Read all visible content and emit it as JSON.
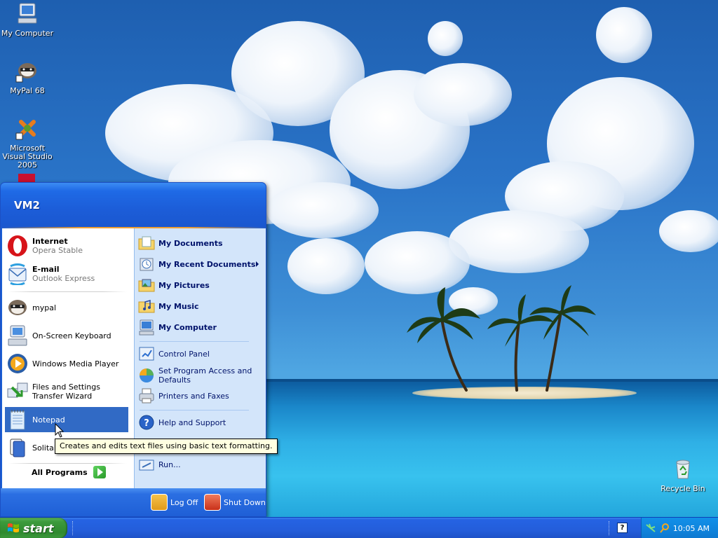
{
  "desktop": {
    "icons": [
      {
        "label": "My Computer",
        "icon": "my-computer-icon"
      },
      {
        "label": "MyPal 68",
        "icon": "mypal-raccoon-icon"
      },
      {
        "label": "Microsoft Visual Studio 2005",
        "icon": "visual-studio-icon"
      },
      {
        "label": "Recycle Bin",
        "icon": "recycle-bin-icon"
      }
    ]
  },
  "start_menu": {
    "user_name": "VM2",
    "pinned": [
      {
        "title": "Internet",
        "subtitle": "Opera Stable",
        "icon": "opera-icon"
      },
      {
        "title": "E-mail",
        "subtitle": "Outlook Express",
        "icon": "outlook-express-icon"
      }
    ],
    "recent": [
      {
        "label": "mypal",
        "icon": "mypal-raccoon-icon"
      },
      {
        "label": "On-Screen Keyboard",
        "icon": "keyboard-icon"
      },
      {
        "label": "Windows Media Player",
        "icon": "media-player-icon"
      },
      {
        "label": "Files and Settings Transfer Wizard",
        "icon": "transfer-wizard-icon"
      },
      {
        "label": "Notepad",
        "icon": "notepad-icon",
        "selected": true
      },
      {
        "label": "Solitaire",
        "icon": "solitaire-icon"
      }
    ],
    "all_programs": "All Programs",
    "places": [
      {
        "label": "My Documents",
        "icon": "documents-folder-icon"
      },
      {
        "label": "My Recent Documents",
        "icon": "recent-documents-icon",
        "submenu": true
      },
      {
        "label": "My Pictures",
        "icon": "pictures-folder-icon"
      },
      {
        "label": "My Music",
        "icon": "music-folder-icon"
      },
      {
        "label": "My Computer",
        "icon": "my-computer-icon"
      }
    ],
    "settings": [
      {
        "label": "Control Panel",
        "icon": "control-panel-icon"
      },
      {
        "label": "Set Program Access and Defaults",
        "icon": "program-access-icon"
      },
      {
        "label": "Printers and Faxes",
        "icon": "printer-icon"
      }
    ],
    "help": [
      {
        "label": "Help and Support",
        "icon": "help-icon"
      },
      {
        "label": "Run...",
        "icon": "run-icon"
      }
    ],
    "footer": {
      "log_off": "Log Off",
      "shut_down": "Shut Down"
    }
  },
  "tooltip": "Creates and edits text files using basic text formatting.",
  "taskbar": {
    "start_label": "start",
    "help_badge": "?",
    "clock": "10:05 AM"
  },
  "colors": {
    "selection": "#316ac5",
    "start_green": "#3c9a3c",
    "taskbar_blue": "#245edb",
    "tooltip_bg": "#ffffe1"
  }
}
